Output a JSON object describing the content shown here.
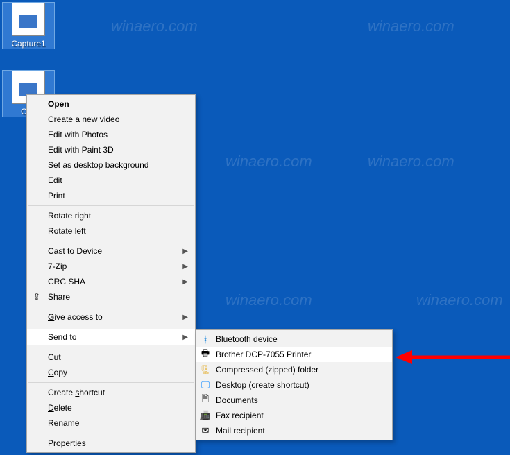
{
  "watermarks": [
    "winaero.com",
    "winaero.com",
    "winaero.com",
    "winaero.com",
    "winaero.com",
    "winaero.com"
  ],
  "desktop": {
    "icons": [
      {
        "label": "Capture1"
      },
      {
        "label": "Cap"
      }
    ]
  },
  "context_menu": {
    "groups": [
      [
        {
          "label_full": "Open",
          "mnemonic_index": 0,
          "arrow": false
        },
        {
          "label_full": "Create a new video",
          "arrow": false
        },
        {
          "label_full": "Edit with Photos",
          "arrow": false
        },
        {
          "label_full": "Edit with Paint 3D",
          "arrow": false
        },
        {
          "label_full": "Set as desktop background",
          "mnemonic_index": 15,
          "arrow": false
        },
        {
          "label_full": "Edit",
          "arrow": false
        },
        {
          "label_full": "Print",
          "arrow": false
        }
      ],
      [
        {
          "label_full": "Rotate right",
          "arrow": false
        },
        {
          "label_full": "Rotate left",
          "arrow": false
        }
      ],
      [
        {
          "label_full": "Cast to Device",
          "arrow": true
        },
        {
          "label_full": "7-Zip",
          "arrow": true
        },
        {
          "label_full": "CRC SHA",
          "arrow": true
        },
        {
          "label_full": "Share",
          "arrow": false,
          "left_icon": "share-icon"
        }
      ],
      [
        {
          "label_full": "Give access to",
          "mnemonic_index": 0,
          "arrow": true
        }
      ],
      [
        {
          "label_full": "Send to",
          "mnemonic_index": 3,
          "arrow": true,
          "hovered": true
        }
      ],
      [
        {
          "label_full": "Cut",
          "mnemonic_index": 2,
          "arrow": false
        },
        {
          "label_full": "Copy",
          "mnemonic_index": 0,
          "arrow": false
        }
      ],
      [
        {
          "label_full": "Create shortcut",
          "mnemonic_index": 7,
          "arrow": false
        },
        {
          "label_full": "Delete",
          "mnemonic_index": 0,
          "arrow": false
        },
        {
          "label_full": "Rename",
          "mnemonic_index": 4,
          "arrow": false
        }
      ],
      [
        {
          "label_full": "Properties",
          "mnemonic_index": 1,
          "arrow": false
        }
      ]
    ]
  },
  "submenu": {
    "items": [
      {
        "label": "Bluetooth device",
        "icon": "bluetooth-icon",
        "icon_color": "#0078d7"
      },
      {
        "label": "Brother DCP-7055 Printer",
        "icon": "printer-icon",
        "hovered": true
      },
      {
        "label": "Compressed (zipped) folder",
        "icon": "zip-icon",
        "icon_color": "#e6b84a"
      },
      {
        "label": "Desktop (create shortcut)",
        "icon": "desktop-icon",
        "icon_color": "#1e90ff"
      },
      {
        "label": "Documents",
        "icon": "documents-icon"
      },
      {
        "label": "Fax recipient",
        "icon": "fax-icon"
      },
      {
        "label": "Mail recipient",
        "icon": "mail-icon"
      }
    ]
  }
}
